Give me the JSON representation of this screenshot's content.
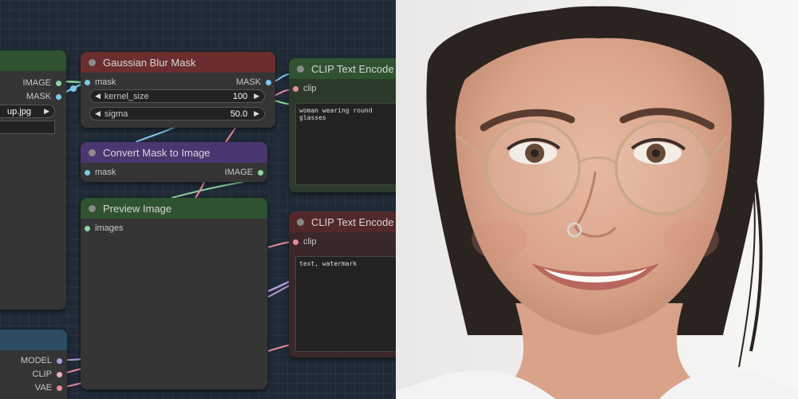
{
  "canvas": {
    "load_image": {
      "outputs": [
        "IMAGE",
        "MASK"
      ],
      "filename": "up.jpg"
    },
    "gaussian_blur": {
      "title": "Gaussian Blur Mask",
      "input": "mask",
      "output": "MASK",
      "kernel_label": "kernel_size",
      "kernel_value": "100",
      "sigma_label": "sigma",
      "sigma_value": "50.0"
    },
    "convert_mask": {
      "title": "Convert Mask to Image",
      "input": "mask",
      "output": "IMAGE"
    },
    "preview": {
      "title": "Preview Image",
      "input": "images"
    },
    "clip_pos": {
      "title": "CLIP Text Encode (F",
      "input": "clip",
      "text": "woman wearing round glasses"
    },
    "clip_neg": {
      "title": "CLIP Text Encode (F",
      "input": "clip",
      "text": "text, watermark"
    },
    "checkpoint": {
      "outputs": [
        "MODEL",
        "CLIP",
        "VAE"
      ]
    },
    "colors": {
      "image": "#64b5f6",
      "mask": "#81c784",
      "clip": "#ffd500",
      "model": "#b39ddb",
      "vae": "#ff6e6e"
    }
  },
  "photo": {
    "icon": "portrait-photo"
  }
}
